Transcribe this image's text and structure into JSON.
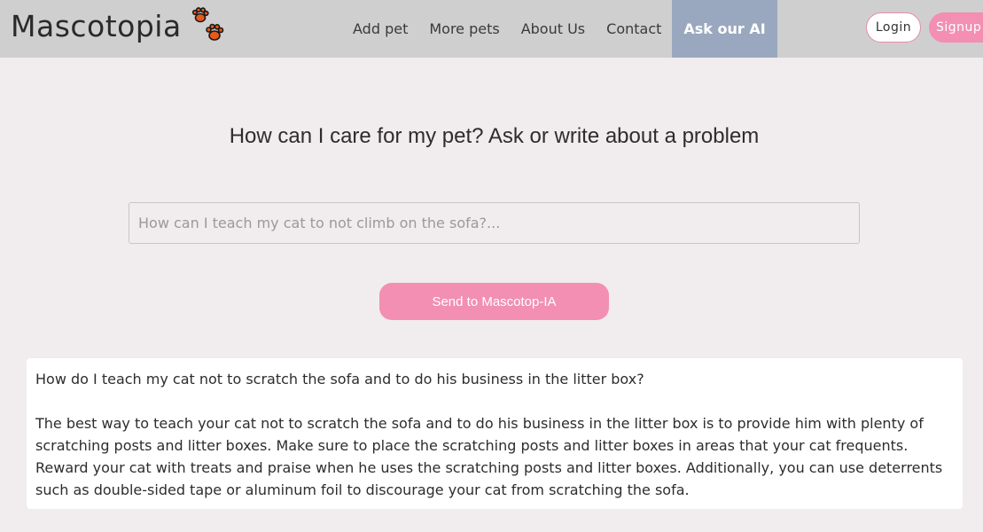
{
  "nav": {
    "brand": "Mascotopia",
    "links": [
      "Add pet",
      "More pets",
      "About Us",
      "Contact",
      "Ask our AI"
    ],
    "active_index": 4,
    "login": "Login",
    "signup": "Signup"
  },
  "main": {
    "heading": "How can I care for my pet? Ask or write about a problem",
    "input_placeholder": "How can I teach my cat to not climb on the sofa?...",
    "send_label": "Send to Mascotop-IA"
  },
  "answer": {
    "question": "How do I teach my cat not to scratch the sofa and to do his business in the litter box?",
    "text": "The best way to teach your cat not to scratch the sofa and to do his business in the litter box is to provide him with plenty of scratching posts and litter boxes. Make sure to place the scratching posts and litter boxes in areas that your cat frequents. Reward your cat with treats and praise when he uses the scratching posts and litter boxes. Additionally, you can use deterrents such as double-sided tape or aluminum foil to discourage your cat from scratching the sofa."
  },
  "colors": {
    "navbar": "#cfcfcf",
    "background": "#f1ecee",
    "accent_pink": "#f28fb3",
    "active_tab": "#9aa8bf",
    "paw_orange": "#e8591a"
  },
  "icons": {
    "brand_logo": "paw-prints-icon"
  }
}
